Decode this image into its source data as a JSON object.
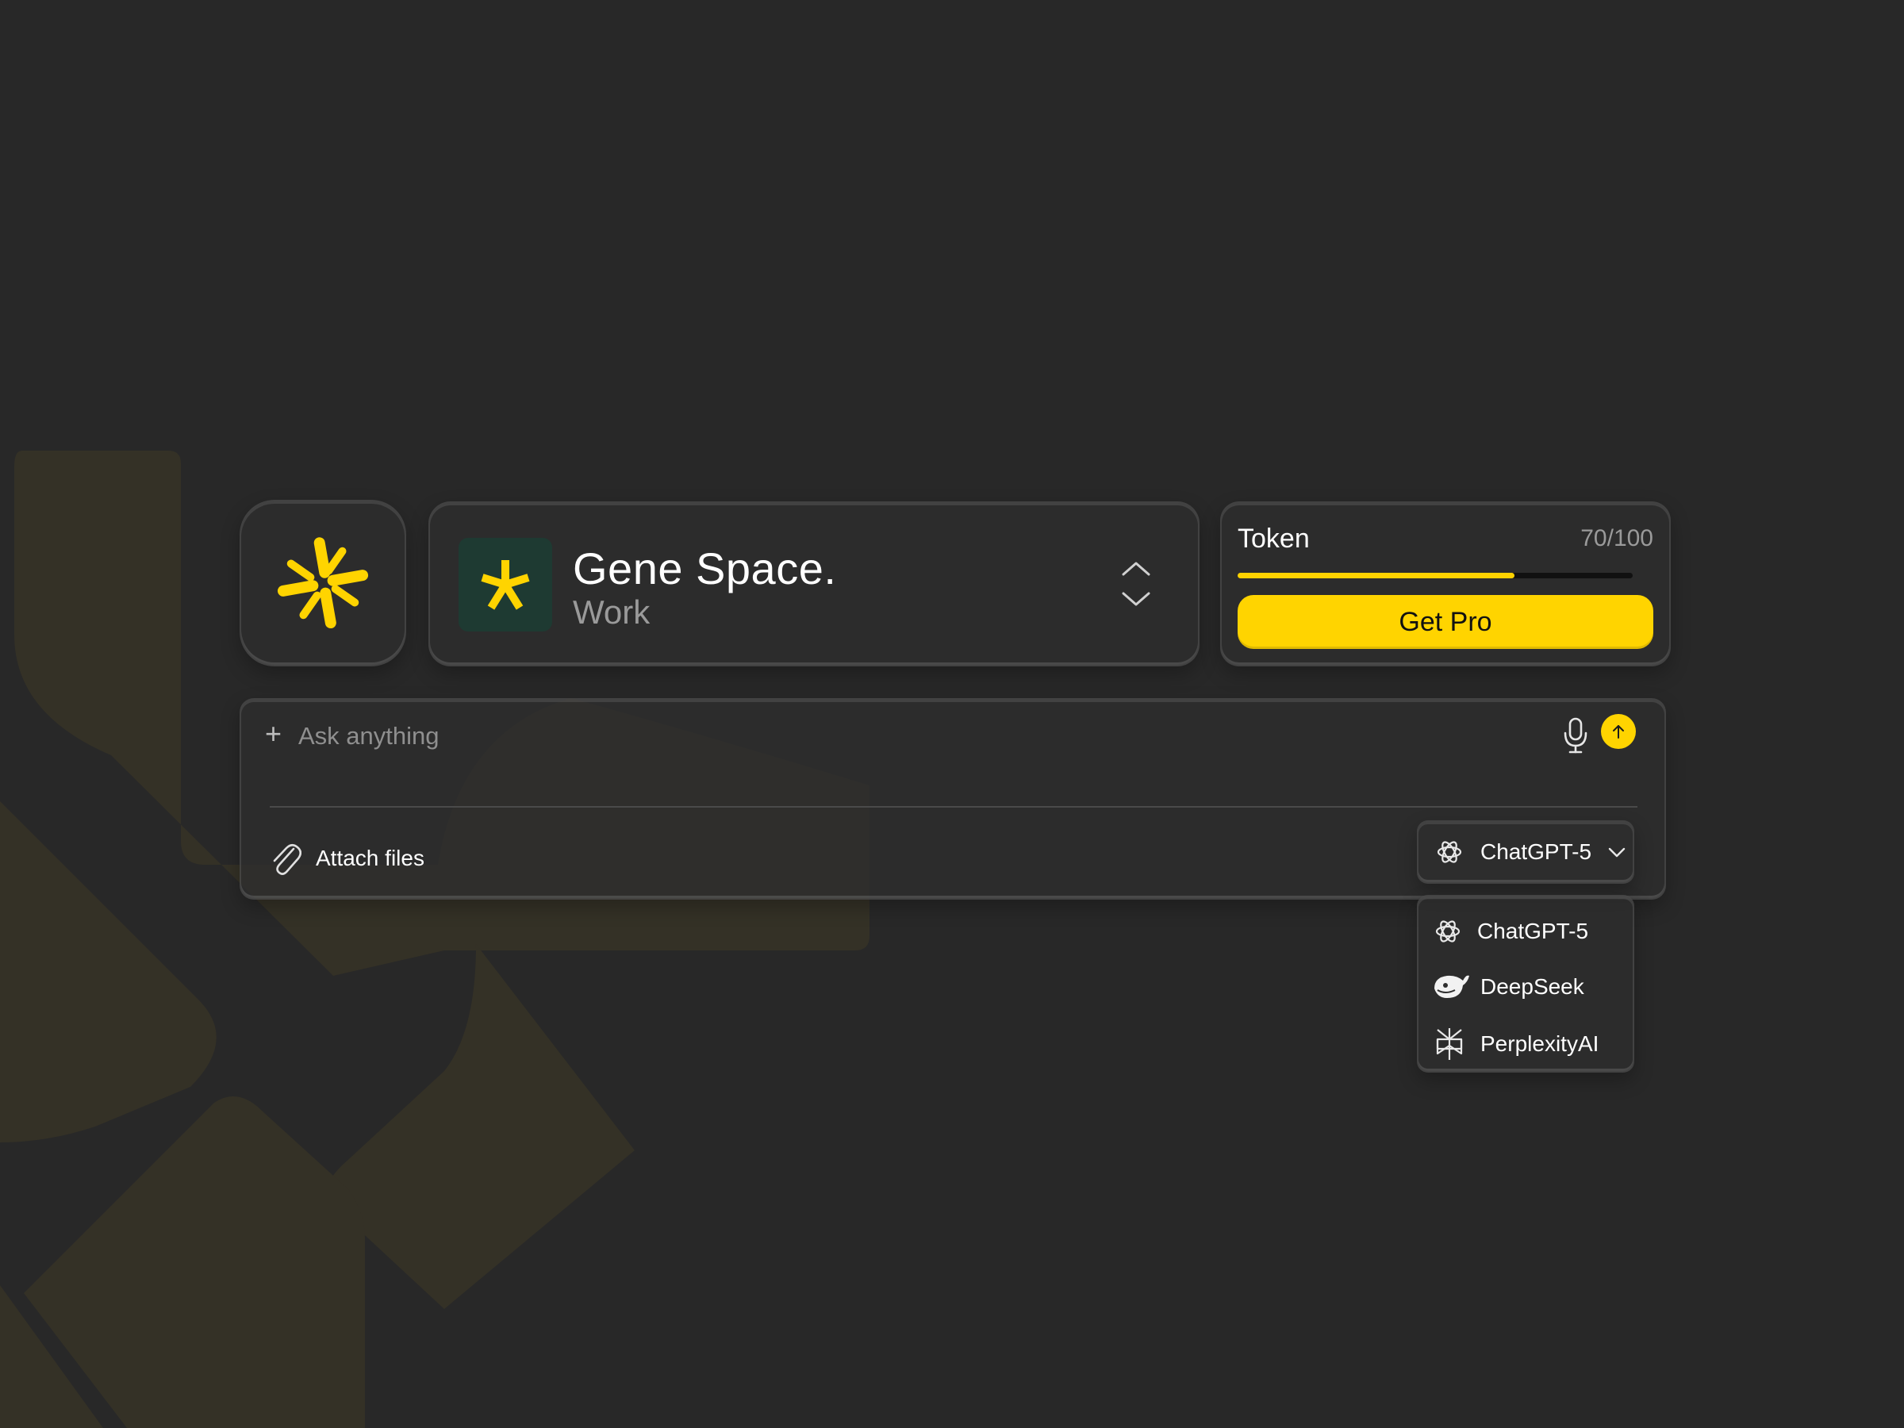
{
  "app": {
    "icon": "pinwheel-logo-icon",
    "accent": "#ffd400"
  },
  "workspace": {
    "name": "Gene Space.",
    "subtitle": "Work",
    "icon": "asterisk-icon",
    "switch_icon": "chevron-up-down-icon"
  },
  "token": {
    "label": "Token",
    "value_text": "70/100",
    "used": 70,
    "total": 100,
    "cta_label": "Get Pro"
  },
  "composer": {
    "add_icon": "plus-icon",
    "plus_glyph": "+",
    "placeholder": "Ask anything",
    "value": "",
    "mic_icon": "microphone-icon",
    "send_icon": "arrow-up-icon",
    "attach_label": "Attach files",
    "attach_icon": "paperclip-icon"
  },
  "model_select": {
    "selected": "ChatGPT-5",
    "icon": "openai-icon"
  },
  "model_menu": {
    "items": [
      {
        "label": "ChatGPT-5",
        "icon": "openai-icon"
      },
      {
        "label": "DeepSeek",
        "icon": "deepseek-whale-icon"
      },
      {
        "label": "PerplexityAI",
        "icon": "perplexity-icon"
      }
    ]
  }
}
